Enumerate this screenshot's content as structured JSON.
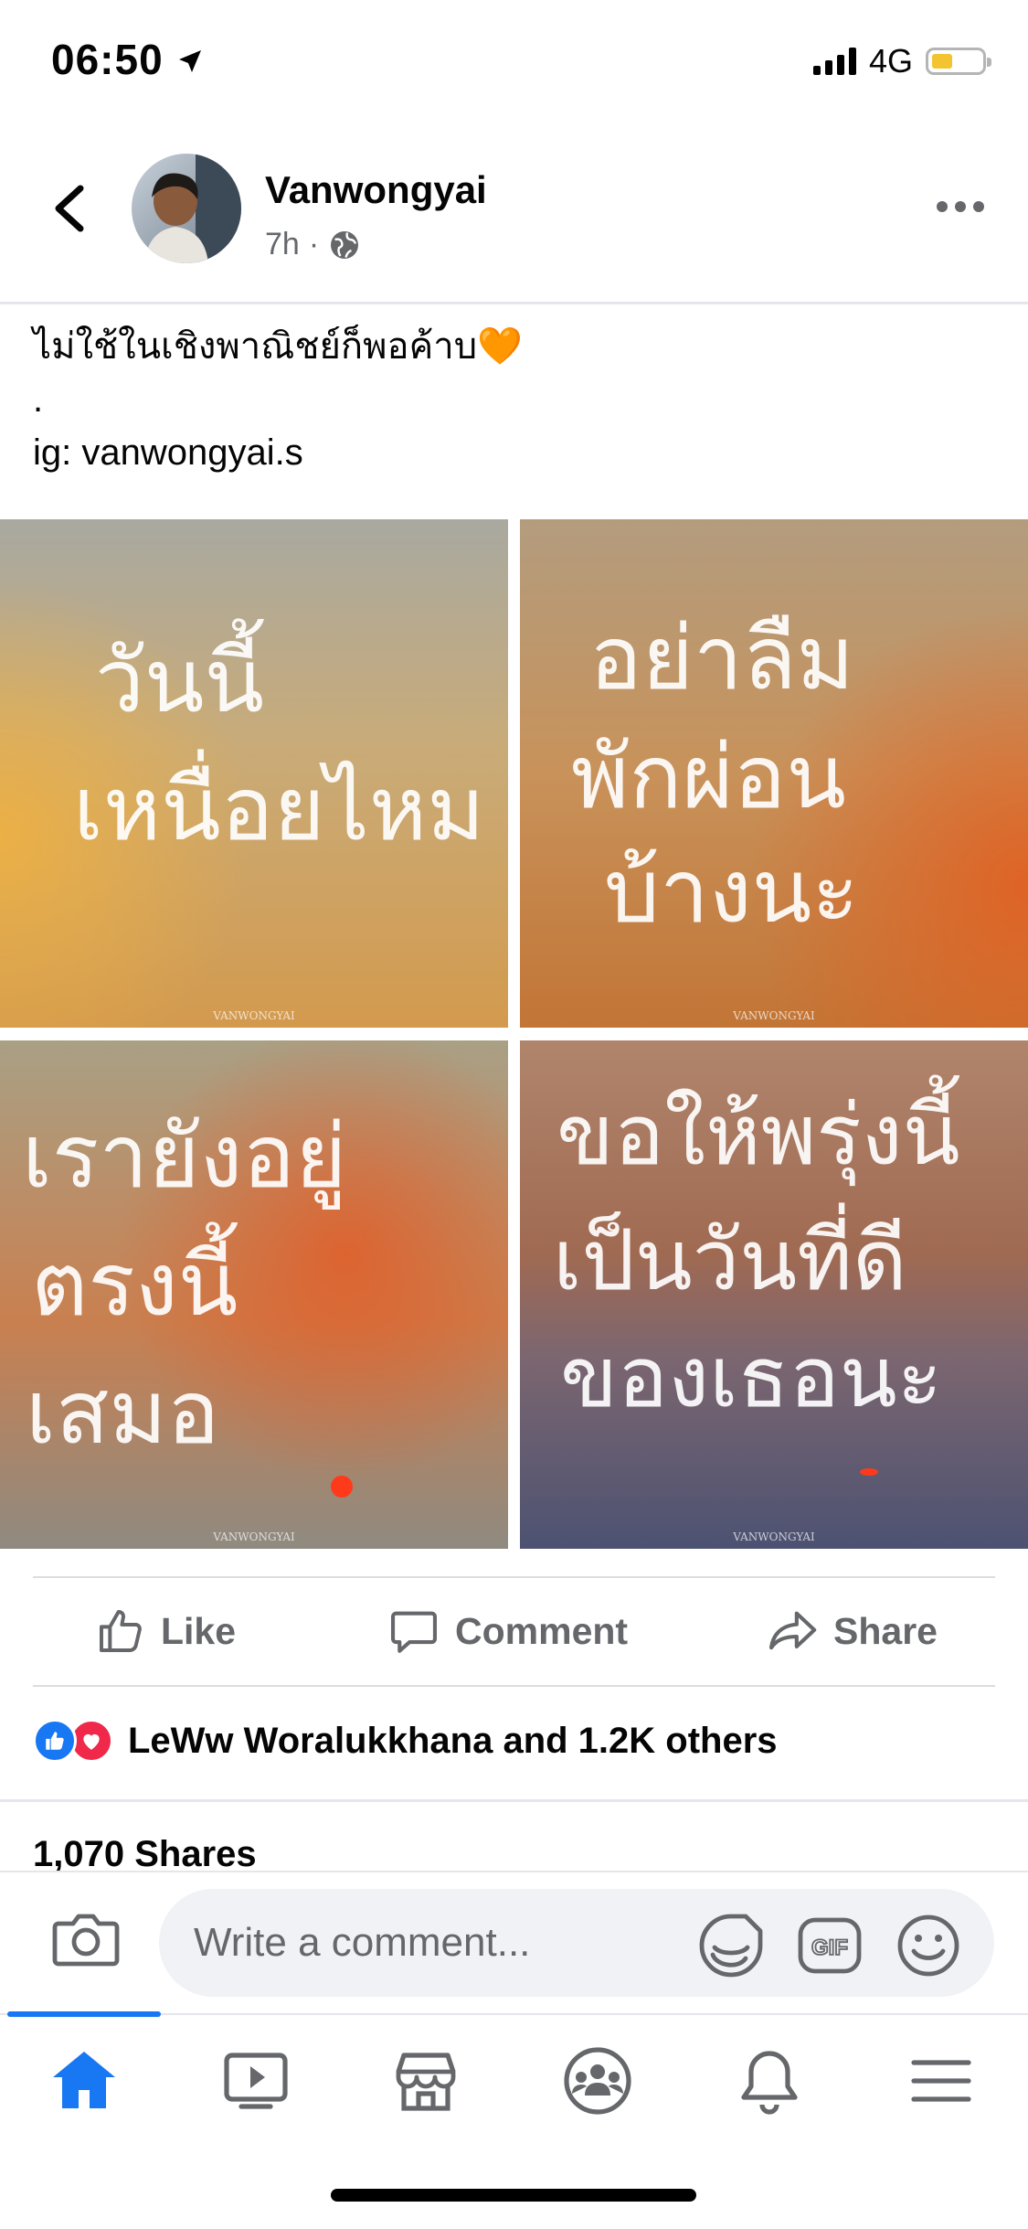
{
  "status_bar": {
    "time": "06:50",
    "network": "4G"
  },
  "post": {
    "author": "Vanwongyai",
    "time": "7h",
    "caption": "ไม่ใช้ในเชิงพาณิชย์ก็พอค้าบ🧡\n.\nig: vanwongyai.s",
    "images": [
      {
        "lines": [
          "วันนี้",
          "เหนื่อยไหม"
        ],
        "watermark": "VANWONGYAI"
      },
      {
        "lines": [
          "อย่าลืม",
          "พักผ่อน",
          "บ้างนะ"
        ],
        "watermark": "VANWONGYAI"
      },
      {
        "lines": [
          "เรายังอยู่",
          "ตรงนี้",
          "เสมอ"
        ],
        "watermark": "VANWONGYAI"
      },
      {
        "lines": [
          "ขอให้พรุ่งนี้",
          "เป็นวันที่ดี",
          "ของเธอนะ"
        ],
        "watermark": "VANWONGYAI"
      }
    ]
  },
  "actions": {
    "like": "Like",
    "comment": "Comment",
    "share": "Share"
  },
  "reactions": {
    "summary": "LeWw Woralukkhana and 1.2K others"
  },
  "shares": "1,070 Shares",
  "composer": {
    "placeholder": "Write a comment...",
    "gif_label": "GIF"
  },
  "colors": {
    "brand": "#1877f2",
    "love": "#f0284a",
    "text_secondary": "#65676b"
  }
}
